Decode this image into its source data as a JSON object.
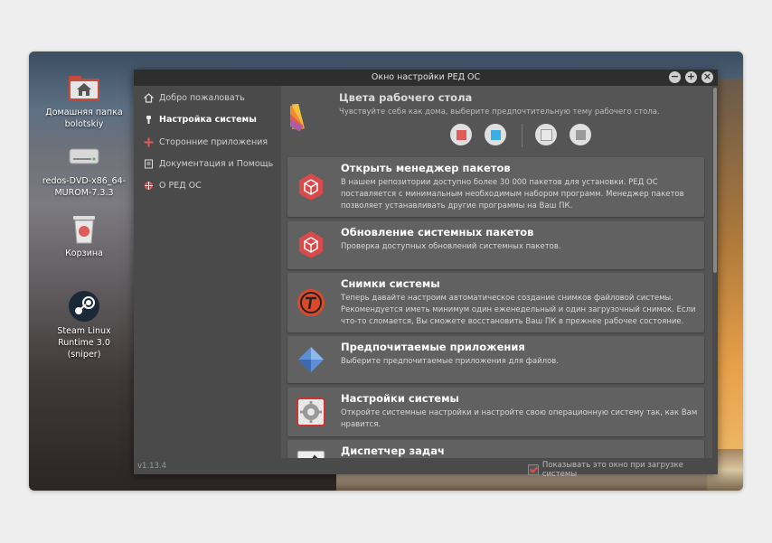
{
  "desktop": {
    "icons": [
      {
        "label": "Домашняя папка bolotskiy"
      },
      {
        "label": "redos-DVD-x86_64-MUROM-7.3.3"
      },
      {
        "label": "Корзина"
      },
      {
        "label": "Steam Linux Runtime 3.0 (sniper)"
      }
    ]
  },
  "window": {
    "title": "Окно настройки РЕД ОС",
    "buttons": {
      "minimize": "−",
      "maximize": "+",
      "close": "×"
    }
  },
  "sidebar": {
    "items": [
      {
        "label": "Добро пожаловать",
        "icon": "home-icon"
      },
      {
        "label": "Настройка системы",
        "icon": "brush-icon",
        "active": true
      },
      {
        "label": "Сторонние приложения",
        "icon": "plus-icon"
      },
      {
        "label": "Документация и Помощь",
        "icon": "book-icon"
      },
      {
        "label": "О РЕД ОС",
        "icon": "lifebuoy-icon"
      }
    ]
  },
  "colors": {
    "title": "Цвета рабочего стола",
    "subtitle": "Чувствуйте себя как дома, выберите предпочтительную тему рабочего стола.",
    "swatches": [
      "#e05a5a",
      "#3aaee8",
      "#e8e8e8",
      "#9a9a9a"
    ]
  },
  "cards": [
    {
      "title": "Открыть менеджер пакетов",
      "desc": "В нашем репозитории доступно более 30 000 пакетов для установки. РЕД ОС поставляется с минимальным необходимым набором программ. Менеджер пакетов позволяет устанавливать другие программы на Ваш ПК.",
      "icon": "package-icon"
    },
    {
      "title": "Обновление системных пакетов",
      "desc": "Проверка доступных обновлений системных пакетов.",
      "icon": "update-package-icon"
    },
    {
      "title": "Снимки системы",
      "desc": "Теперь давайте настроим автоматическое создание снимков файловой системы. Рекомендуется иметь минимум один еженедельный и один загрузочный снимок. Если что-то сломается, Вы сможете восстановить Ваш ПК в прежнее рабочее состояние.",
      "icon": "snapshot-icon"
    },
    {
      "title": "Предпочитаемые приложения",
      "desc": "Выберите предпочитаемые приложения для файлов.",
      "icon": "preferred-apps-icon"
    },
    {
      "title": "Настройки системы",
      "desc": "Откройте системные настройки и настройте свою операционную систему так, как Вам нравится.",
      "icon": "settings-gear-icon"
    },
    {
      "title": "Диспетчер задач",
      "desc": "",
      "icon": "task-manager-icon"
    }
  ],
  "footer": {
    "version": "v1.13.4",
    "checkbox_label": "Показывать это окно при загрузке системы",
    "checked": true
  }
}
